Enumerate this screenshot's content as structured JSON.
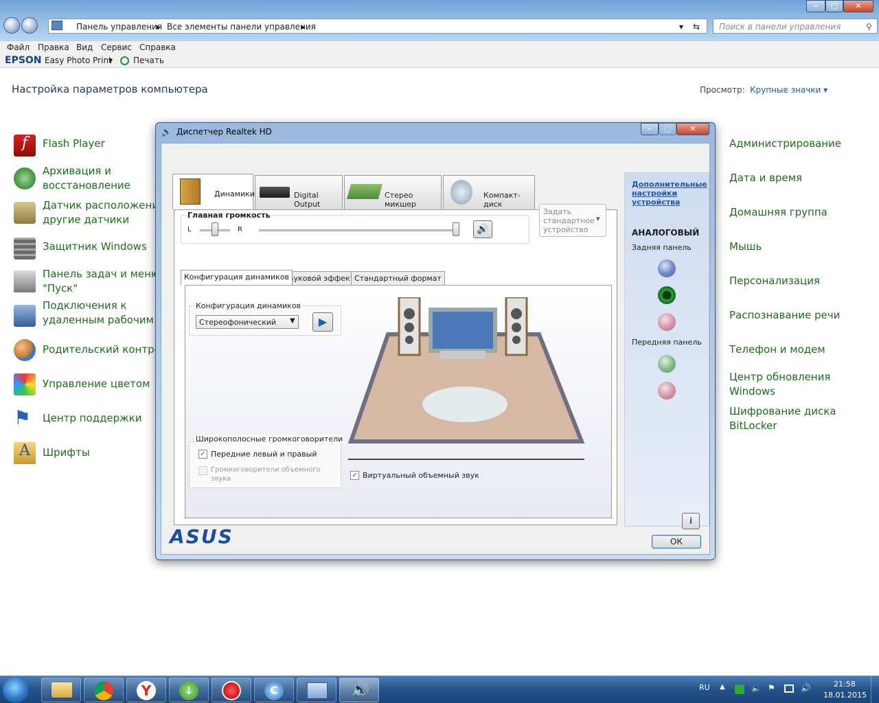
{
  "explorer": {
    "breadcrumb": [
      "Панель управления",
      "Все элементы панели управления"
    ],
    "search_placeholder": "Поиск в панели управления",
    "menu": [
      "Файл",
      "Правка",
      "Вид",
      "Сервис",
      "Справка"
    ],
    "epson": {
      "brand": "EPSON",
      "app": "Easy Photo Print",
      "print": "Печать"
    },
    "heading": "Настройка параметров компьютера",
    "view_label": "Просмотр:",
    "view_value": "Крупные значки"
  },
  "left_items": [
    {
      "label": "Flash Player",
      "icon": "flash-icon"
    },
    {
      "label": "Архивация и\nвосстановление",
      "icon": "backup-icon"
    },
    {
      "label": "Датчик расположения\nдругие датчики",
      "icon": "sensor-icon"
    },
    {
      "label": "Защитник Windows",
      "icon": "defender-icon"
    },
    {
      "label": "Панель задач и меню\n\"Пуск\"",
      "icon": "taskbar-icon"
    },
    {
      "label": "Подключения к\nудаленным рабочим",
      "icon": "remote-icon"
    },
    {
      "label": "Родительский контрол",
      "icon": "parental-icon"
    },
    {
      "label": "Управление цветом",
      "icon": "color-icon"
    },
    {
      "label": "Центр поддержки",
      "icon": "flag-icon"
    },
    {
      "label": "Шрифты",
      "icon": "fonts-icon"
    }
  ],
  "right_items": [
    {
      "label": "Администрирование"
    },
    {
      "label": "Дата и время"
    },
    {
      "label": "Домашняя группа"
    },
    {
      "label": "Мышь"
    },
    {
      "label": "Персонализация"
    },
    {
      "label": "Распознавание речи"
    },
    {
      "label": "Телефон и модем"
    },
    {
      "label": "Центр обновления\nWindows"
    },
    {
      "label": "Шифрование диска\nBitLocker"
    }
  ],
  "dialog": {
    "title": "Диспетчер Realtek HD",
    "tabs": [
      "Динамики",
      "Digital Output",
      "Стерео микшер",
      "Компакт-диск"
    ],
    "volume_label": "Главная громкость",
    "left": "L",
    "right": "R",
    "default_device": "Задать\nстандартное\nустройство",
    "subtabs": [
      "Конфигурация динамиков",
      "Звуковой эффект",
      "Стандартный формат"
    ],
    "config_label": "Конфигурация динамиков",
    "config_value": "Стереофонический",
    "wide_label": "Широкополосные громкоговорители",
    "check_front": "Передние левый и правый",
    "check_surround": "Громкоговорители объемного\nзвука",
    "virtual": "Виртуальный объемный звук",
    "side_link": "Дополнительные\nнастройки\nустройства",
    "analog": "АНАЛОГОВЫЙ",
    "rear": "Задняя панель",
    "front": "Передняя панель",
    "brand": "ASUS",
    "ok": "ОК"
  },
  "taskbar": {
    "lang": "RU",
    "time": "21:58",
    "date": "18.01.2015"
  }
}
